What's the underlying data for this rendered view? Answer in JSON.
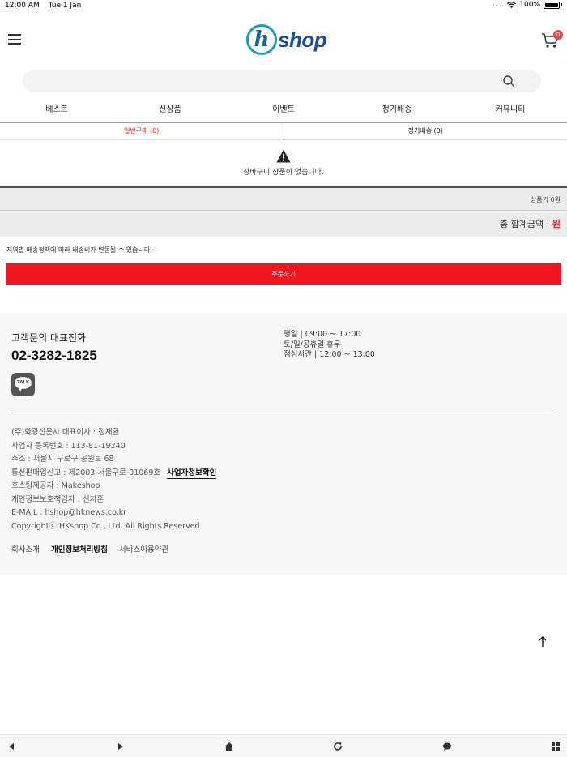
{
  "status_bar": {
    "time": "12:00 AM",
    "date": "Tue 1 Jan",
    "signal": "....",
    "battery": "100%"
  },
  "header": {
    "logo_letter": "h",
    "logo_text": "shop",
    "cart_count": "0"
  },
  "search": {
    "placeholder": ""
  },
  "nav": {
    "items": [
      "베스트",
      "신상품",
      "이벤트",
      "정기배송",
      "커뮤니티"
    ]
  },
  "tabs": [
    {
      "label": "일반구매 (0)",
      "active": true
    },
    {
      "label": "정기배송 (0)",
      "active": false
    }
  ],
  "cart": {
    "empty_message": "장바구니 상품이 없습니다.",
    "subtotal": "상품가 0원",
    "total_label": "총 합계금액 : ",
    "total_value": "원"
  },
  "notice": "지역별 배송정책에 따라 배송비가 변동될 수 있습니다.",
  "order_button": "주문하기",
  "footer": {
    "cs_title": "고객문의 대표전화",
    "cs_phone": "02-3282-1825",
    "hours": [
      "평일 | 09:00 ~ 17:00",
      "토/일/공휴일 휴무",
      "점심시간 | 12:00 ~ 13:00"
    ],
    "talk_label": "TALK",
    "company_lines": [
      "(주)화광신문사 대표이사 : 정재환",
      "사업자 등록번호 : 113-81-19240",
      "주소 : 서울시 구로구 공원로 68",
      "통신판매업신고 : 제2003-서울구로-01069호",
      "호스팅제공자 : Makeshop",
      "개인정보보호책임자 : 신지훈",
      "E-MAIL : hshop@hknews.co.kr",
      "Copyrightⓒ HKshop Co., Ltd. All Rights Reserved"
    ],
    "biz_info_link": "사업자정보확인",
    "links": [
      "회사소개",
      "개인정보처리방침",
      "서비스이용약관"
    ]
  },
  "colors": {
    "accent_red": "#f0161f",
    "logo_blue": "#1b4f9c",
    "logo_teal": "#1b9bb0"
  }
}
